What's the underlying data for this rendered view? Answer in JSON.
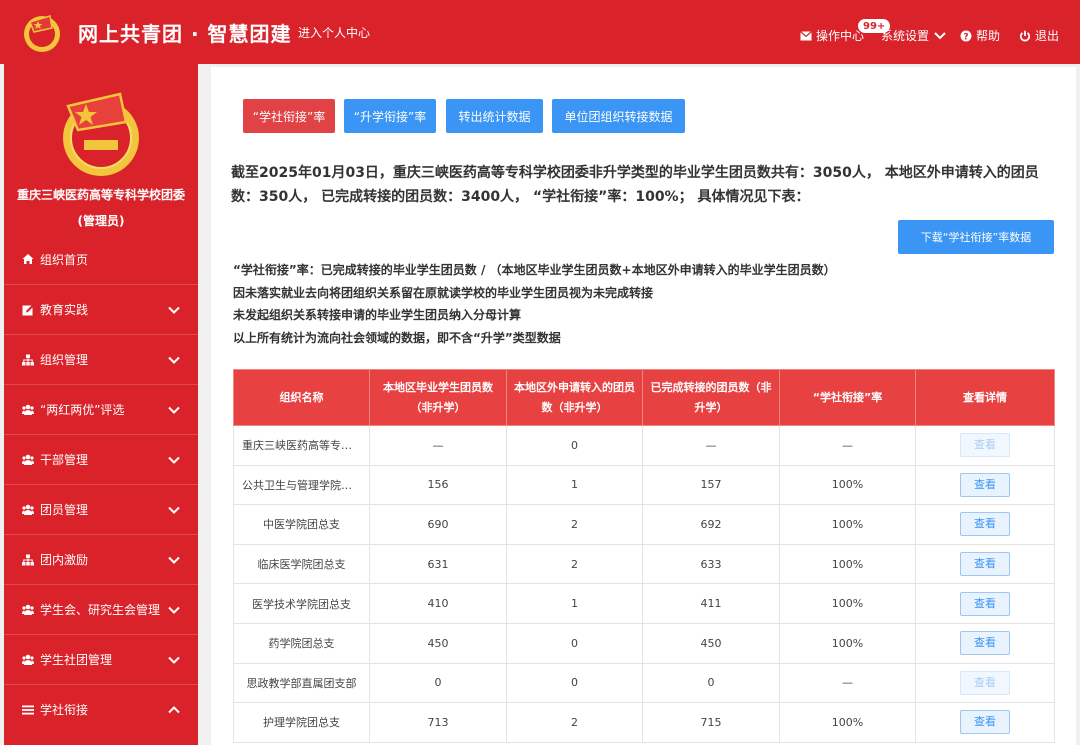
{
  "header": {
    "brand": "网上共青团 · 智慧团建",
    "personal_center": "进入个人中心",
    "actions": {
      "operation_center": "操作中心",
      "badge": "99+",
      "system_settings": "系统设置",
      "help": "帮助",
      "logout": "退出"
    },
    "colors": {
      "primary": "#d9222a"
    }
  },
  "sidebar": {
    "org_name": "重庆三峡医药高等专科学校团委",
    "role": "(管理员)",
    "items": [
      {
        "label": "组织首页",
        "icon": "home-icon"
      },
      {
        "label": "教育实践",
        "icon": "edit-icon"
      },
      {
        "label": "组织管理",
        "icon": "sitemap-icon"
      },
      {
        "label": "“两红两优”评选",
        "icon": "group-icon"
      },
      {
        "label": "干部管理",
        "icon": "group-icon"
      },
      {
        "label": "团员管理",
        "icon": "group-icon"
      },
      {
        "label": "团内激励",
        "icon": "sitemap-icon"
      },
      {
        "label": "学生会、研究生会管理",
        "icon": "group-icon"
      },
      {
        "label": "学生社团管理",
        "icon": "group-icon"
      },
      {
        "label": "学社衔接",
        "icon": "list-icon"
      }
    ]
  },
  "tabs": [
    {
      "label": "“学社衔接”率",
      "style": "red"
    },
    {
      "label": "“升学衔接”率",
      "style": "blue"
    },
    {
      "label": "转出统计数据",
      "style": "blue"
    },
    {
      "label": "单位团组织转接数据",
      "style": "blue"
    }
  ],
  "summary": "截至2025年01月03日，重庆三峡医药高等专科学校团委非升学类型的毕业学生团员数共有：3050人， 本地区外申请转入的团员数：350人， 已完成转接的团员数：3400人， “学社衔接”率：100%； 具体情况见下表：",
  "download_label": "下载“学社衔接”率数据",
  "notes": [
    "“学社衔接”率：已完成转接的毕业学生团员数 / （本地区毕业学生团员数+本地区外申请转入的毕业学生团员数）",
    "因未落实就业去向将团组织关系留在原就读学校的毕业学生团员视为未完成转接",
    "未发起组织关系转接申请的毕业学生团员纳入分母计算",
    "以上所有统计为流向社会领域的数据，即不含“升学”类型数据"
  ],
  "table": {
    "headers": [
      "组织名称",
      "本地区毕业学生团员数（非升学）",
      "本地区外申请转入的团员数（非升学）",
      "已完成转接的团员数（非升学）",
      "“学社衔接”率",
      "查看详情"
    ],
    "view_label": "查看",
    "rows": [
      {
        "name": "重庆三峡医药高等专科学校团委",
        "local": "—",
        "transfer_in": "0",
        "completed": "—",
        "rate": "—",
        "enabled": false
      },
      {
        "name": "公共卫生与管理学院团总支",
        "local": "156",
        "transfer_in": "1",
        "completed": "157",
        "rate": "100%",
        "enabled": true
      },
      {
        "name": "中医学院团总支",
        "local": "690",
        "transfer_in": "2",
        "completed": "692",
        "rate": "100%",
        "enabled": true
      },
      {
        "name": "临床医学院团总支",
        "local": "631",
        "transfer_in": "2",
        "completed": "633",
        "rate": "100%",
        "enabled": true
      },
      {
        "name": "医学技术学院团总支",
        "local": "410",
        "transfer_in": "1",
        "completed": "411",
        "rate": "100%",
        "enabled": true
      },
      {
        "name": "药学院团总支",
        "local": "450",
        "transfer_in": "0",
        "completed": "450",
        "rate": "100%",
        "enabled": true
      },
      {
        "name": "思政教学部直属团支部",
        "local": "0",
        "transfer_in": "0",
        "completed": "0",
        "rate": "—",
        "enabled": false
      },
      {
        "name": "护理学院团总支",
        "local": "713",
        "transfer_in": "2",
        "completed": "715",
        "rate": "100%",
        "enabled": true
      }
    ]
  }
}
